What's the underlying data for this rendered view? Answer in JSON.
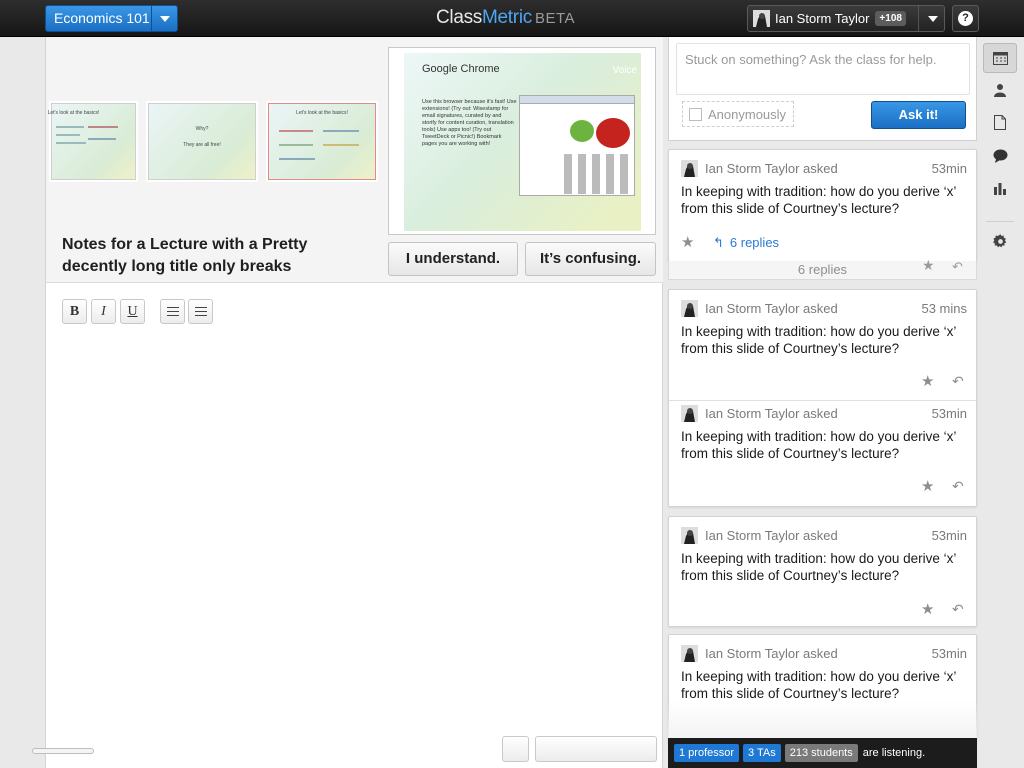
{
  "header": {
    "course_label": "Economics 101",
    "brand_class": "Class",
    "brand_metric": "Metric",
    "brand_beta": "BETA",
    "user_name": "Ian Storm Taylor",
    "user_count": "+108",
    "help_label": "?"
  },
  "slides": {
    "thumb1_text": "Let's look at the basics!",
    "thumb2_line1": "Why?",
    "thumb2_line2": "They are all free!",
    "thumb3_title": "Let's look at the basics!",
    "current_title": "Google Chrome",
    "current_logo": "Voice",
    "current_body": "Use this browser because it's fast! Use extensions! (Try out: Wisestamp for email signatures, curated by and storify for content curation, translation tools) Use apps too! (Try out TweetDeck or Picnic!) Bookmark pages you are working with!"
  },
  "notes": {
    "title": "Notes for a Lecture with a Pretty decently long title only breaks",
    "understand_label": "I understand.",
    "confusing_label": "It’s confusing.",
    "toolbar": {
      "bold": "B",
      "italic": "I",
      "underline": "U"
    }
  },
  "ask": {
    "placeholder": "Stuck on something? Ask the class for help.",
    "anonymous_label": "Anonymously",
    "button_label": "Ask it!"
  },
  "questions": [
    {
      "asker": "Ian Storm Taylor asked",
      "time": "53min",
      "text": "In keeping with tradition: how do you derive ‘x’ from this slide of Courtney’s lecture?",
      "replies": "6 replies"
    },
    {
      "asker": "Ian Storm Taylor asked",
      "time": "53 mins",
      "text": "In keeping with tradition: how do you derive ‘x’ from this slide of Courtney’s lecture?"
    },
    {
      "asker": "Ian Storm Taylor asked",
      "time": "53min",
      "text": "In keeping with tradition: how do you derive ‘x’ from this slide of Courtney’s lecture?"
    },
    {
      "asker": "Ian Storm Taylor asked",
      "time": "53min",
      "text": "In keeping with tradition: how do you derive ‘x’ from this slide of Courtney’s lecture?"
    },
    {
      "asker": "Ian Storm Taylor asked",
      "time": "53min",
      "text": "In keeping with tradition: how do you derive ‘x’ from this slide of Courtney’s lecture?"
    }
  ],
  "replies_collapsed": "6 replies",
  "status": {
    "professor": "1 professor",
    "tas": "3 TAs",
    "students": "213 students",
    "suffix": "are listening."
  },
  "side_icons": [
    "calendar-icon",
    "user-icon",
    "document-icon",
    "speech-bubble-icon",
    "bar-chart-icon",
    "gear-icon"
  ]
}
